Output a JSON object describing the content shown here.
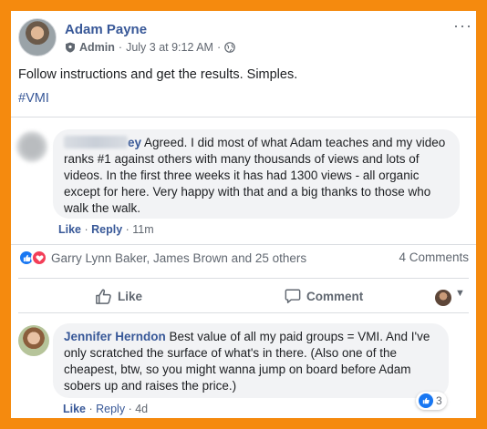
{
  "post": {
    "author": "Adam Payne",
    "role": "Admin",
    "timestamp": "July 3 at 9:12 AM",
    "text": "Follow instructions and get the results. Simples.",
    "hashtag": "#VMI",
    "more": "···"
  },
  "comment1": {
    "name_suffix": "ey",
    "text": "Agreed. I did most of what Adam teaches and my video ranks #1 against others with many thousands of views and lots of videos. In the first three weeks it has had 1300 views - all organic except for here. Very happy with that and a big thanks to those who walk the walk.",
    "like": "Like",
    "reply": "Reply",
    "time": "11m"
  },
  "reactions": {
    "names": "Garry Lynn Baker, James Brown and 25 others",
    "comments_count": "4 Comments"
  },
  "actions": {
    "like": "Like",
    "comment": "Comment"
  },
  "comment2": {
    "name": "Jennifer Herndon",
    "text": "Best value of all my paid groups = VMI. And I've only scratched the surface of what's in there. (Also one of the cheapest, btw, so you might wanna jump on board before Adam sobers up and raises the price.)",
    "reaction_count": "3",
    "like": "Like",
    "reply": "Reply",
    "time": "4d"
  },
  "colors": {
    "frame": "#f58a0e",
    "link": "#385898",
    "like_blue": "#1877f2",
    "love_red": "#f33e58"
  }
}
